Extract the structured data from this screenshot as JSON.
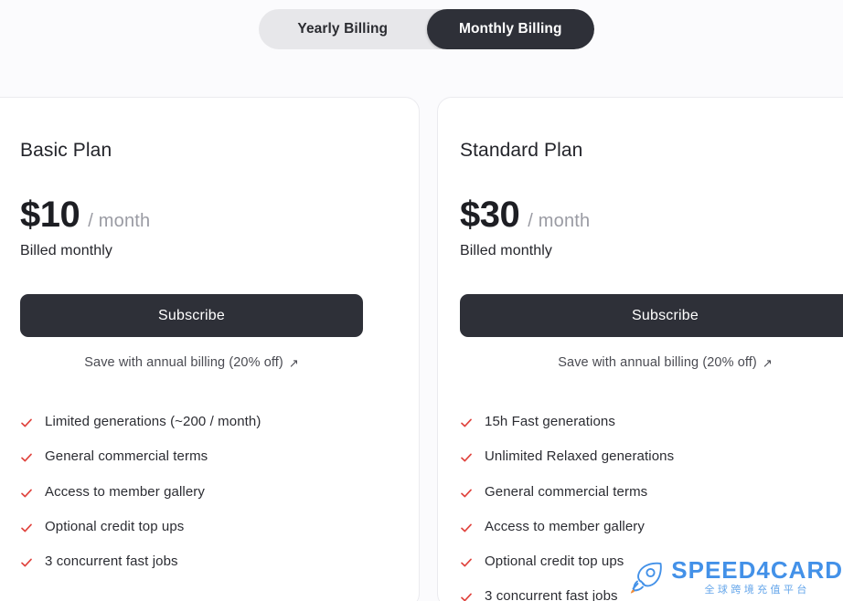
{
  "billing_toggle": {
    "name": "billing-period-toggle",
    "options": [
      {
        "label": "Yearly Billing",
        "active": false
      },
      {
        "label": "Monthly Billing",
        "active": true
      }
    ],
    "active_value": "Monthly Billing",
    "active_bg": "#2e3038",
    "track_bg": "#e7e7ea"
  },
  "plans": [
    {
      "name": "Basic Plan",
      "price": "$10",
      "period": "/ month",
      "billed_note": "Billed monthly",
      "cta_label": "Subscribe",
      "annual_link": "Save with annual billing (20% off)",
      "annual_link_icon": "arrow-up-right-icon",
      "features": [
        "Limited generations (~200 / month)",
        "General commercial terms",
        "Access to member gallery",
        "Optional credit top ups",
        "3 concurrent fast jobs"
      ]
    },
    {
      "name": "Standard Plan",
      "price": "$30",
      "period": "/ month",
      "billed_note": "Billed monthly",
      "cta_label": "Subscribe",
      "annual_link": "Save with annual billing (20% off)",
      "annual_link_icon": "arrow-up-right-icon",
      "features": [
        "15h Fast generations",
        "Unlimited Relaxed generations",
        "General commercial terms",
        "Access to member gallery",
        "Optional credit top ups",
        "3 concurrent fast jobs"
      ]
    }
  ],
  "watermark": {
    "title": "SPEED4CARD",
    "subtitle": "全球跨境充值平台",
    "icon": "rocket-icon",
    "color": "#3d8ee8"
  },
  "colors": {
    "page_bg": "#fbfbfd",
    "card_bg": "#ffffff",
    "card_border": "#ebebef",
    "dark": "#2e3038",
    "check": "#e0443e",
    "muted": "#9a9ba3"
  }
}
